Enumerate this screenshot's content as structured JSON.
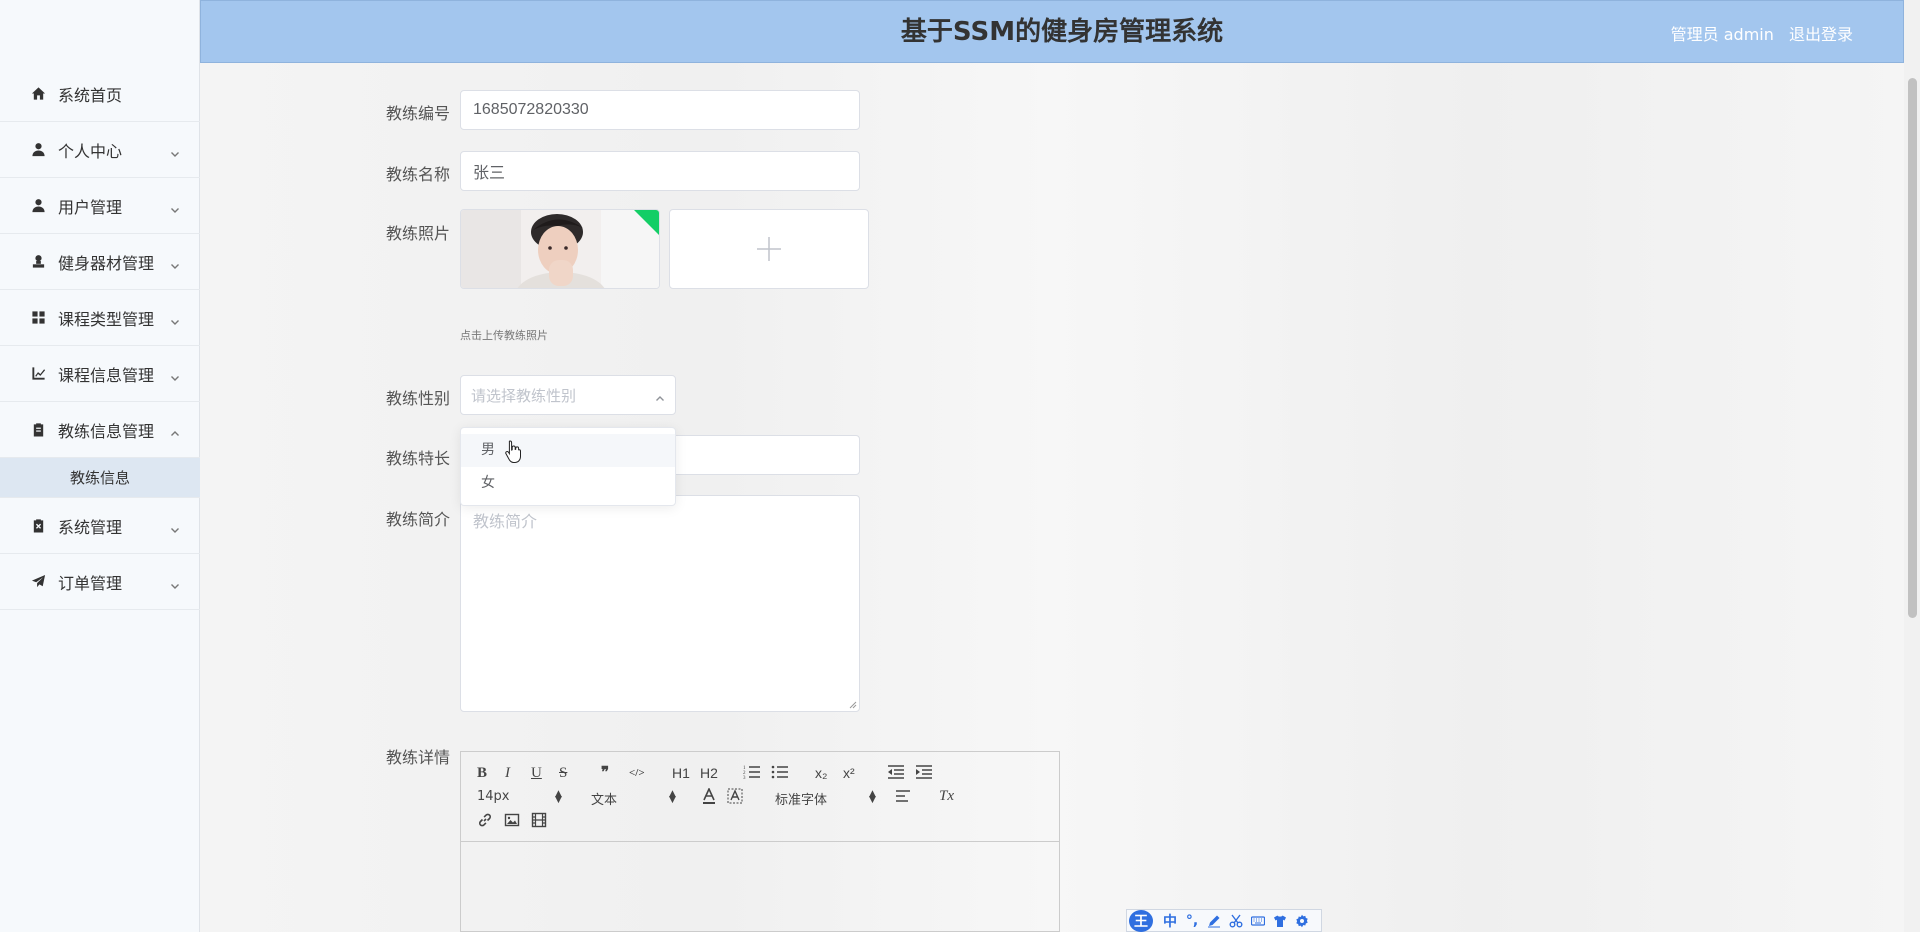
{
  "app": {
    "title": "基于SSM的健身房管理系统",
    "user_label": "管理员 admin",
    "logout_label": "退出登录"
  },
  "sidebar": {
    "items": [
      {
        "label": "系统首页",
        "icon": "home-icon"
      },
      {
        "label": "个人中心",
        "icon": "user-icon"
      },
      {
        "label": "用户管理",
        "icon": "user-icon"
      },
      {
        "label": "健身器材管理",
        "icon": "stamp-icon"
      },
      {
        "label": "课程类型管理",
        "icon": "grid-icon"
      },
      {
        "label": "课程信息管理",
        "icon": "chart-icon"
      },
      {
        "label": "教练信息管理",
        "icon": "clipboard-icon"
      },
      {
        "label": "系统管理",
        "icon": "clipboard-x-icon"
      },
      {
        "label": "订单管理",
        "icon": "send-icon"
      }
    ],
    "active_sub_item": "教练信息"
  },
  "form": {
    "coach_no_label": "教练编号",
    "coach_no_value": "1685072820330",
    "coach_name_label": "教练名称",
    "coach_name_value": "张三",
    "coach_photo_label": "教练照片",
    "photo_tip": "点击上传教练照片",
    "coach_gender_label": "教练性别",
    "coach_gender_placeholder": "请选择教练性别",
    "gender_options": [
      "男",
      "女"
    ],
    "coach_specialty_label": "教练特长",
    "coach_intro_label": "教练简介",
    "coach_intro_placeholder": "教练简介",
    "coach_detail_label": "教练详情"
  },
  "editor": {
    "font_size": "14px",
    "header_select": "文本",
    "font_family": "标准字体",
    "buttons": {
      "bold": "B",
      "italic": "I",
      "underline": "U",
      "strike": "S",
      "quote": "❞",
      "code": "</>",
      "h1": "H1",
      "h2": "H2",
      "sub": "x₂",
      "sup": "x²",
      "clean": "Tx"
    }
  },
  "ime": {
    "logo": "王",
    "mode": "中",
    "punct": "°,"
  },
  "colors": {
    "header_bg": "#a3c6ee",
    "sidebar_bg": "#f6f9fc",
    "active_sub_bg": "#dde7f2",
    "ime_accent": "#2f6fe0"
  }
}
